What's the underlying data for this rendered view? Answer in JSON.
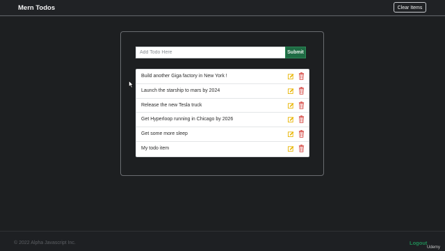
{
  "navbar": {
    "brand": "Mern Todos",
    "clear_label": "Clear Items"
  },
  "form": {
    "placeholder": "Add Todo Here",
    "value": "",
    "submit_label": "Submit"
  },
  "todos": [
    {
      "text": "Build another Giga factory in New York !",
      "edit_icon": "pencil-square-icon",
      "delete_icon": "trash-icon"
    },
    {
      "text": "Launch the starship to mars by 2024",
      "edit_icon": "pencil-square-icon",
      "delete_icon": "trash-icon"
    },
    {
      "text": "Release the new Tesla truck",
      "edit_icon": "pencil-square-icon",
      "delete_icon": "trash-icon"
    },
    {
      "text": "Get Hyperloop running in Chicago by 2026",
      "edit_icon": "pencil-square-icon",
      "delete_icon": "trash-icon"
    },
    {
      "text": "Get some more sleep",
      "edit_icon": "pencil-square-icon",
      "delete_icon": "trash-icon"
    },
    {
      "text": "My todo item",
      "edit_icon": "pencil-square-icon",
      "delete_icon": "trash-icon"
    }
  ],
  "footer": {
    "copyright": "© 2022 Alpha Javascript Inc.",
    "logout_label": "Logout",
    "watermark": "Udemy"
  },
  "colors": {
    "background": "#1d1f21",
    "accent_green": "#1f6b44",
    "logout_green": "#1f8a55",
    "edit_icon": "#e8b400",
    "delete_icon": "#d9534f"
  }
}
